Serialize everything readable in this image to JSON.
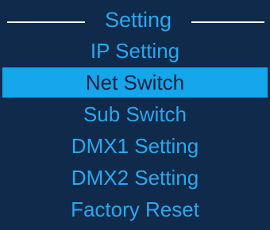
{
  "header": {
    "title": "Setting"
  },
  "menu": {
    "items": [
      {
        "label": "IP Setting",
        "selected": false
      },
      {
        "label": "Net Switch",
        "selected": true
      },
      {
        "label": "Sub Switch",
        "selected": false
      },
      {
        "label": "DMX1 Setting",
        "selected": false
      },
      {
        "label": "DMX2 Setting",
        "selected": false
      },
      {
        "label": "Factory Reset",
        "selected": false
      }
    ]
  },
  "colors": {
    "background": "#102a4c",
    "text": "#2aa8ee",
    "highlight": "#15a6ec",
    "highlight_text": "#0d1f3e",
    "rule": "#ffffff"
  }
}
